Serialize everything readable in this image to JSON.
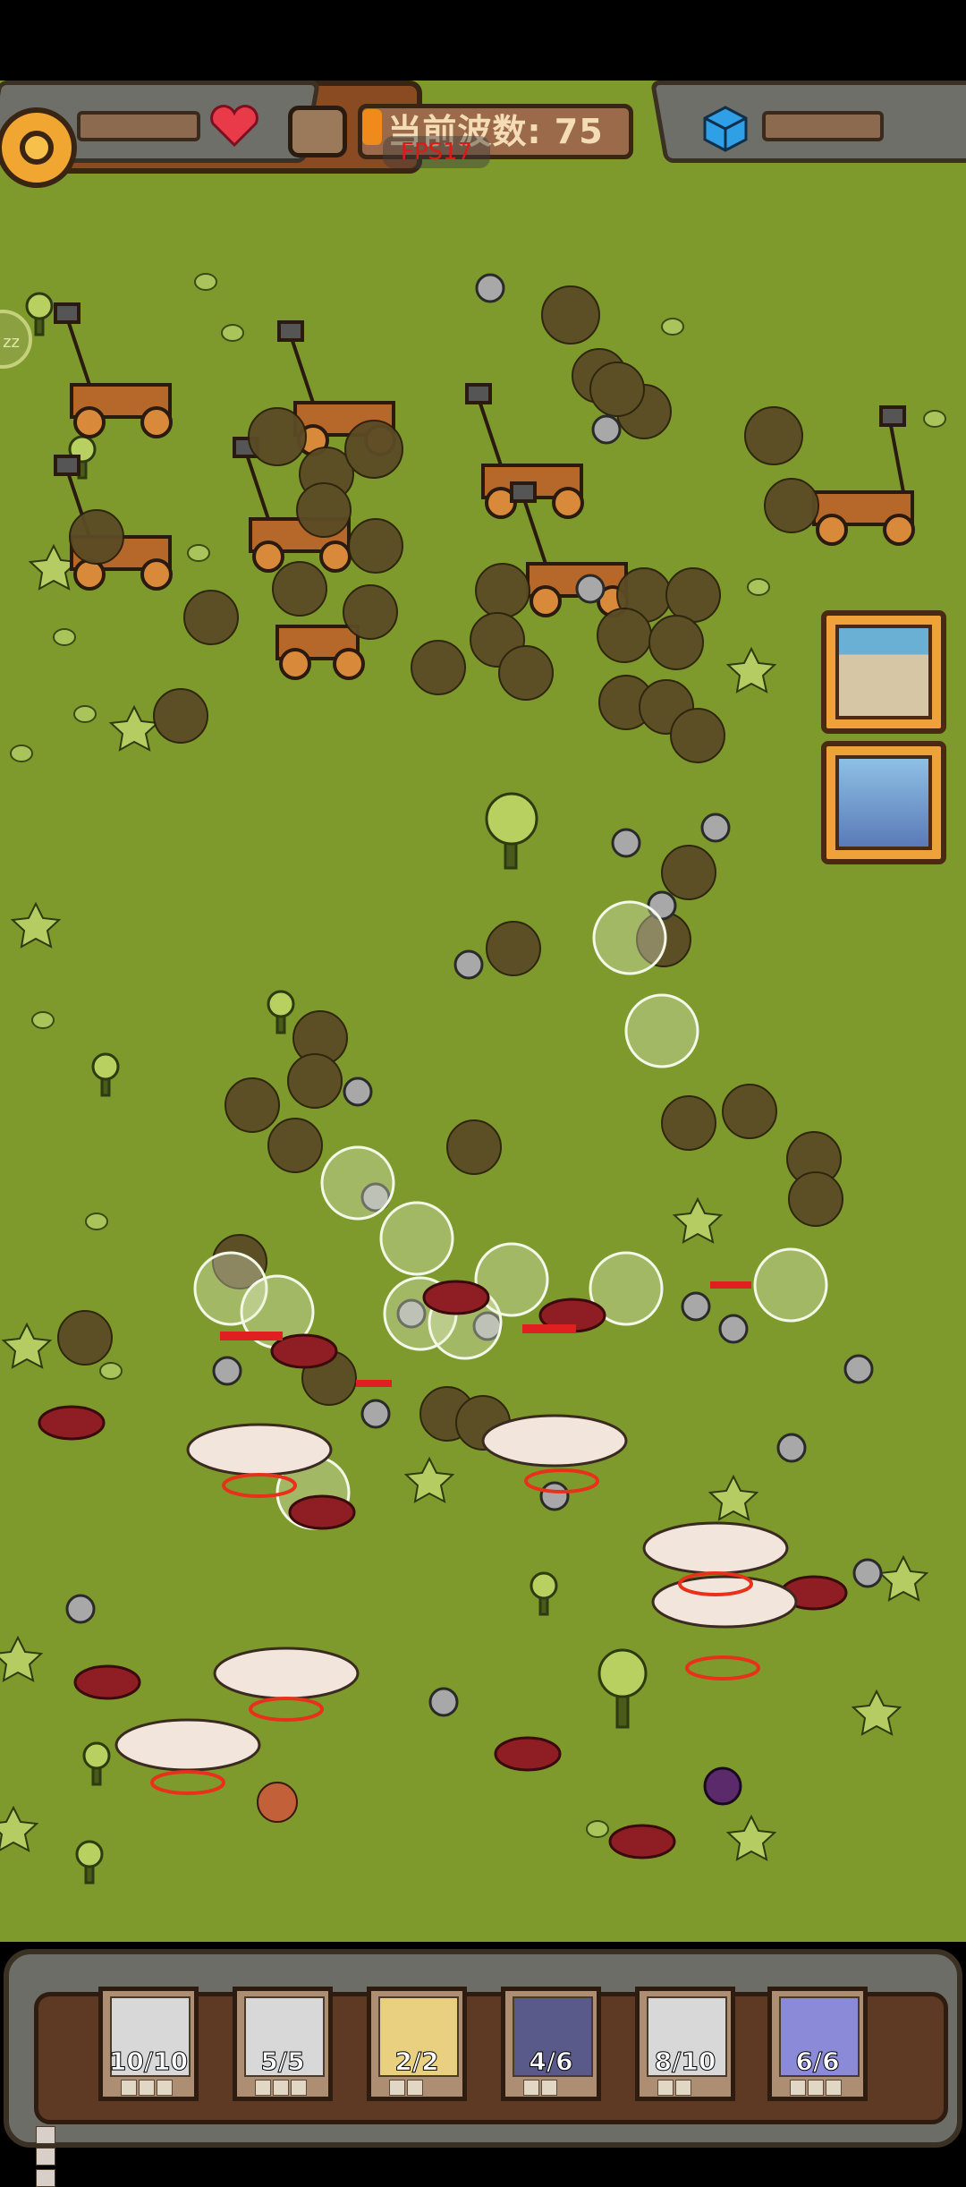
{
  "hud": {
    "settings_icon": "gear-icon",
    "health_icon": "heart-icon",
    "armor_icon": "shield-icon",
    "resource_icon": "cube-icon",
    "wave_label": "当前波数: 75",
    "fps_label": "FPS17",
    "heart_color": "#e83a48",
    "cube_color": "#2f9fe6"
  },
  "side": {
    "sleep_label": "zz"
  },
  "skills": [
    {
      "name": "archer-volley-skill"
    },
    {
      "name": "siege-engine-skill"
    }
  ],
  "tray": {
    "units": [
      {
        "type": "archer",
        "count": "10/10",
        "color": "#c43a3a"
      },
      {
        "type": "ballista",
        "count": "5/5",
        "color": "#6b4a2e"
      },
      {
        "type": "monk",
        "count": "2/2",
        "color": "#f0c040"
      },
      {
        "type": "spartan",
        "count": "4/6",
        "color": "#3b3a6a"
      },
      {
        "type": "footman",
        "count": "8/10",
        "color": "#888888"
      },
      {
        "type": "cavalry",
        "count": "6/6",
        "color": "#7060c0"
      }
    ]
  }
}
